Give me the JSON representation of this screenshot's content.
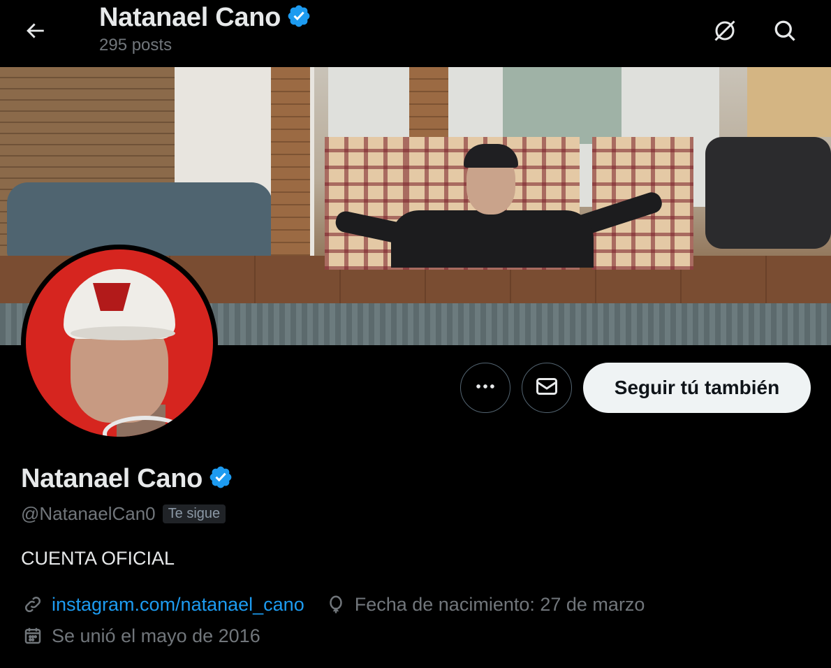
{
  "header": {
    "title": "Natanael Cano",
    "posts_count": "295 posts",
    "back_icon": "arrow-left-icon",
    "grok_icon": "grok-icon",
    "search_icon": "search-icon"
  },
  "banner": {
    "description_icon": "banner-image"
  },
  "profile": {
    "display_name": "Natanael Cano",
    "verified_icon": "verified-badge-icon",
    "handle": "@NatanaelCan0",
    "follows_you": "Te sigue",
    "bio": "CUENTA OFICIAL",
    "website": "instagram.com/natanael_cano",
    "birthday": "Fecha de nacimiento: 27 de marzo",
    "joined": "Se unió el mayo de 2016"
  },
  "actions": {
    "more_icon": "more-dots-icon",
    "message_icon": "mail-icon",
    "follow_label": "Seguir tú también"
  },
  "colors": {
    "background": "#000000",
    "text": "#e7e9ea",
    "secondary": "#71767b",
    "accent": "#1d9bf0",
    "follow_btn_bg": "#eff3f4"
  }
}
